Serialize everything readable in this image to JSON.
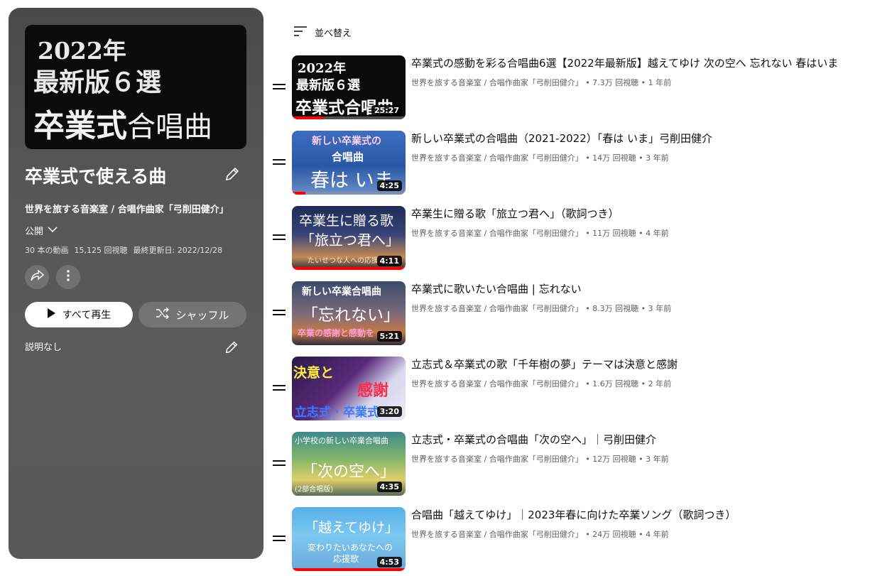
{
  "playlist": {
    "hero": {
      "line1": "2022年",
      "line2": "最新版６選",
      "line3_big": "卒業式",
      "line3_small": "合唱曲"
    },
    "title": "卒業式で使える曲",
    "owner": "世界を旅する音楽室 / 合唱作曲家「弓削田健介」",
    "privacy": "公開",
    "video_count": "30 本の動画",
    "views": "15,125 回視聴",
    "last_updated": "最終更新日: 2022/12/28",
    "play_all_label": "すべて再生",
    "shuffle_label": "シャッフル",
    "description": "説明なし"
  },
  "sort_label": "並べ替え",
  "videos": [
    {
      "title": "卒業式の感動を彩る合唱曲6選【2022年最新版】越えてゆけ 次の空へ 忘れない 春はいま",
      "meta": "世界を旅する音楽室 / 合唱作曲家「弓削田健介」 • 7.3万 回視聴 • 1 年前",
      "duration": "25:27",
      "progress": 0.28,
      "thumb": {
        "l1": "2022年",
        "l2": "最新版６選",
        "l3": "卒業式合唱曲"
      }
    },
    {
      "title": "新しい卒業式の合唱曲（2021-2022）「春は いま」弓削田健介",
      "meta": "世界を旅する音楽室 / 合唱作曲家「弓削田健介」 • 14万 回視聴 • 3 年前",
      "duration": "4:25",
      "progress": 0.12,
      "thumb": {
        "l1": "新しい卒業式の",
        "l2": "合唱曲",
        "l3": "春は いま"
      }
    },
    {
      "title": "卒業生に贈る歌「旅立つ君へ」（歌詞つき）",
      "meta": "世界を旅する音楽室 / 合唱作曲家「弓削田健介」 • 11万 回視聴 • 4 年前",
      "duration": "4:11",
      "progress": 1.0,
      "thumb": {
        "l1": "卒業生に贈る歌",
        "l2": "「旅立つ君へ」",
        "l3": "たいせつな人への応援歌"
      }
    },
    {
      "title": "卒業式に歌いたい合唱曲 | 忘れない",
      "meta": "世界を旅する音楽室 / 合唱作曲家「弓削田健介」 • 8.3万 回視聴 • 3 年前",
      "duration": "5:21",
      "progress": 0.0,
      "thumb": {
        "l1": "新しい卒業合唱曲",
        "l2": "「忘れない」",
        "l3": "卒業の感謝と感動を"
      }
    },
    {
      "title": "立志式＆卒業式の歌「千年樹の夢」テーマは決意と感謝",
      "meta": "世界を旅する音楽室 / 合唱作曲家「弓削田健介」 • 1.6万 回視聴 • 2 年前",
      "duration": "3:20",
      "progress": 0.0,
      "thumb": {
        "l1": "決意と",
        "l2": "感謝",
        "l3": "立志式・卒業式"
      }
    },
    {
      "title": "立志式・卒業式の合唱曲「次の空へ」｜弓削田健介",
      "meta": "世界を旅する音楽室 / 合唱作曲家「弓削田健介」 • 12万 回視聴 • 3 年前",
      "duration": "4:35",
      "progress": 0.0,
      "thumb": {
        "l1": "小学校の新しい卒業合唱曲",
        "l2": "「次の空へ」",
        "l3": "(2部合唱版)"
      }
    },
    {
      "title": "合唱曲「越えてゆけ」｜2023年春に向けた卒業ソング（歌詞つき）",
      "meta": "世界を旅する音楽室 / 合唱作曲家「弓削田健介」 • 24万 回視聴 • 4 年前",
      "duration": "4:53",
      "progress": 1.0,
      "thumb": {
        "l1": "「越えてゆけ」",
        "l2": "変わりたいあなたへの",
        "l3": "応援歌"
      }
    }
  ],
  "icons": {
    "edit": "pencil-icon",
    "privacy_dropdown": "chevron-down-icon",
    "share": "share-icon",
    "more": "more-vert-icon",
    "play": "play-icon",
    "shuffle": "shuffle-icon",
    "sort": "sort-icon",
    "drag": "drag-handle-icon"
  },
  "colors": {
    "accent_red": "#ff0000",
    "panel_bg": "#575757"
  }
}
